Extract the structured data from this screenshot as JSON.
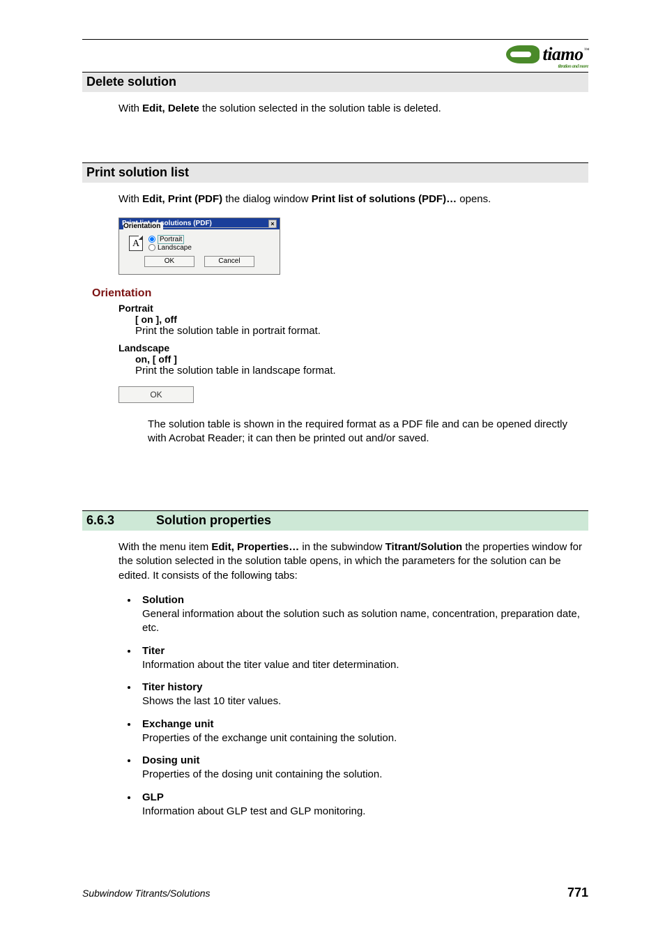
{
  "logo": {
    "name": "tiamo",
    "tm": "™",
    "tagline": "titration and more"
  },
  "s1": {
    "heading": "Delete solution",
    "para_prefix": "With ",
    "para_bold": "Edit, Delete",
    "para_suffix": " the solution selected in the solution table is deleted."
  },
  "s2": {
    "heading": "Print solution list",
    "para_prefix": "With ",
    "para_bold": "Edit, Print (PDF)",
    "para_mid": " the dialog window ",
    "para_bold2": "Print list of solutions (PDF)…",
    "para_suffix": " opens."
  },
  "dialog": {
    "title": "Print list of solutions (PDF)",
    "fieldset": "Orientation",
    "icon_letter": "A",
    "opt_portrait": "Portrait",
    "opt_landscape": "Landscape",
    "ok": "OK",
    "cancel": "Cancel"
  },
  "orientation": {
    "heading": "Orientation",
    "portrait": {
      "name": "Portrait",
      "state": "[ on ], off",
      "desc": "Print the solution table in portrait format."
    },
    "landscape": {
      "name": "Landscape",
      "state": "on, [ off ]",
      "desc": "Print the solution table in landscape format."
    },
    "ok_label": "OK",
    "ok_desc": "The solution table is shown in the required format as a PDF file and can be opened directly with Acrobat Reader; it can then be printed out and/or saved."
  },
  "s3": {
    "num": "6.6.3",
    "heading": "Solution properties",
    "intro_prefix": "With the menu item ",
    "intro_b1": "Edit, Properties…",
    "intro_mid": " in the subwindow ",
    "intro_b2": "Titrant/Solution",
    "intro_suffix": " the properties window for the solution selected in the solution table opens, in which the parameters for the solution can be edited. It consists of the following tabs:",
    "bullets": [
      {
        "name": "Solution",
        "desc": "General information about the solution such as solution name, concentration, preparation date, etc."
      },
      {
        "name": "Titer",
        "desc": "Information about the titer value and titer determination."
      },
      {
        "name": "Titer history",
        "desc": "Shows the last 10 titer values."
      },
      {
        "name": "Exchange unit",
        "desc": "Properties of the exchange unit containing the solution."
      },
      {
        "name": "Dosing unit",
        "desc": "Properties of the dosing unit containing the solution."
      },
      {
        "name": "GLP",
        "desc": "Information about GLP test and GLP monitoring."
      }
    ]
  },
  "footer": {
    "section": "Subwindow Titrants/Solutions",
    "page": "771"
  }
}
